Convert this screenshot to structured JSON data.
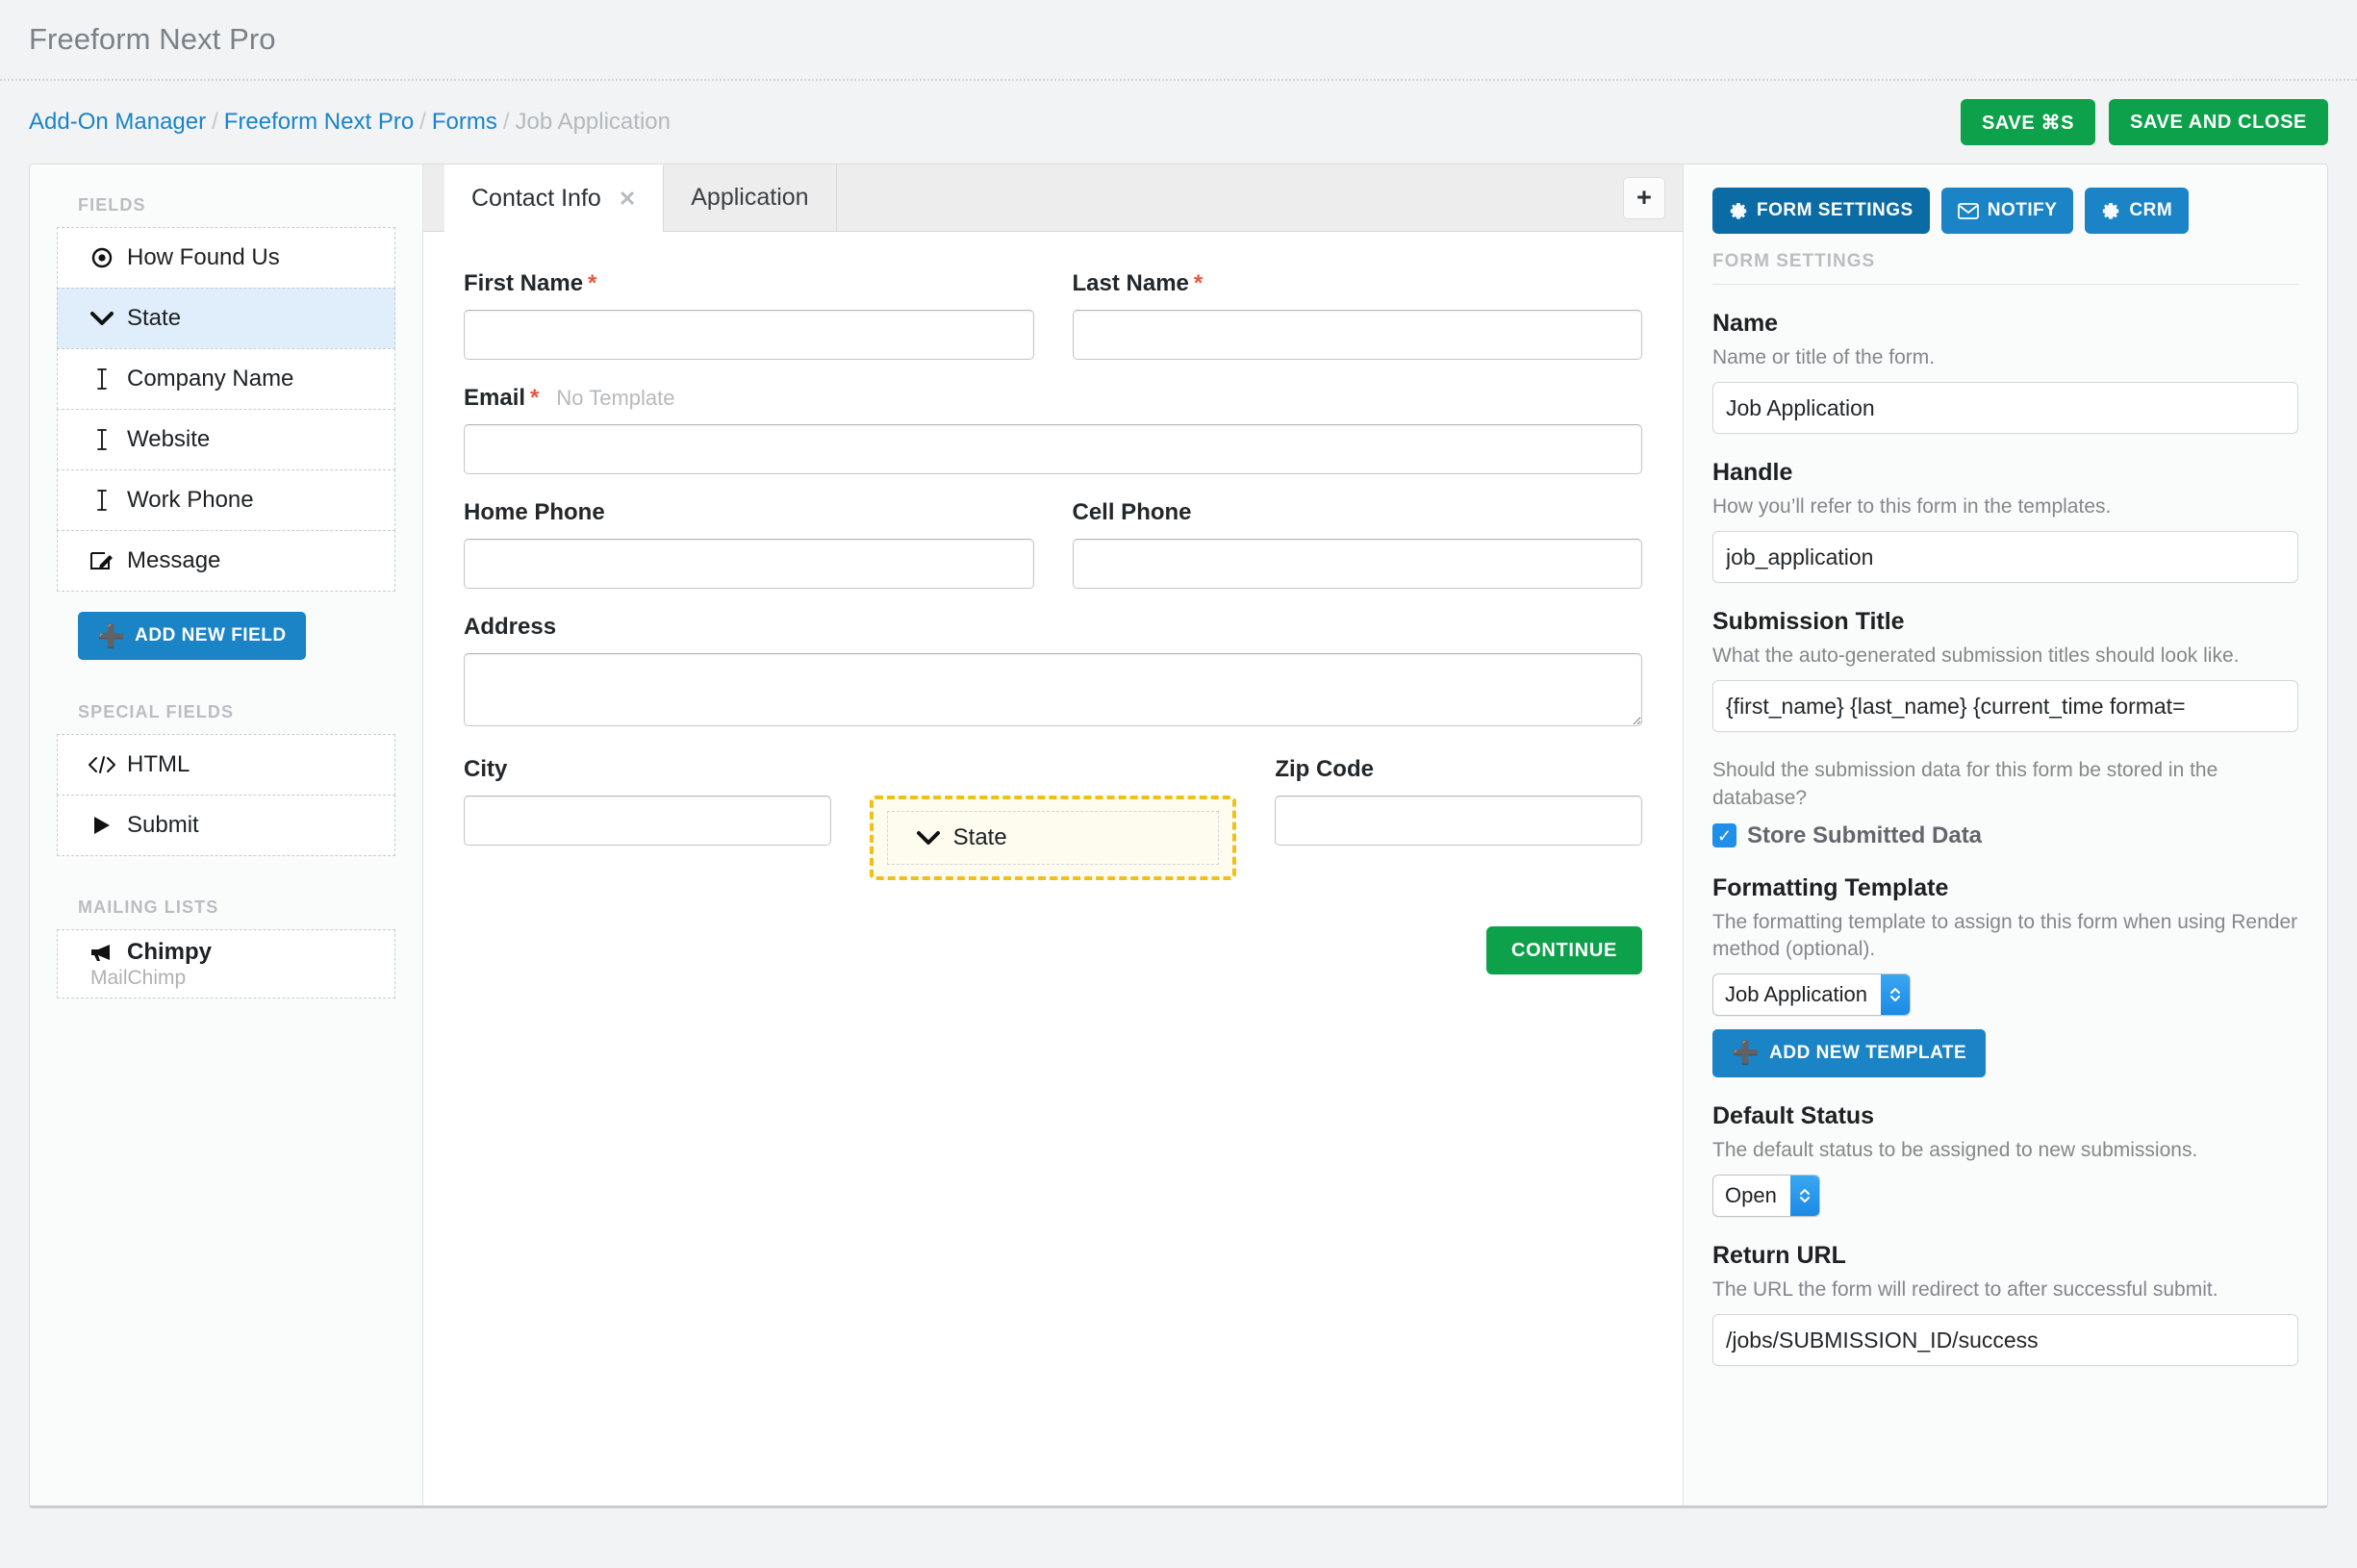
{
  "app": {
    "title": "Freeform Next Pro"
  },
  "breadcrumb": {
    "items": [
      "Add-On Manager",
      "Freeform Next Pro",
      "Forms",
      "Job Application"
    ],
    "separator": "/"
  },
  "actions": {
    "save_label": "SAVE ⌘S",
    "save_close_label": "SAVE AND CLOSE"
  },
  "sidebar": {
    "fields_heading": "FIELDS",
    "fields": [
      {
        "label": "How Found Us",
        "icon": "radio-icon"
      },
      {
        "label": "State",
        "icon": "chevron-down-icon",
        "active": true
      },
      {
        "label": "Company Name",
        "icon": "text-cursor-icon"
      },
      {
        "label": "Website",
        "icon": "text-cursor-icon"
      },
      {
        "label": "Work Phone",
        "icon": "text-cursor-icon"
      },
      {
        "label": "Message",
        "icon": "textarea-pencil-icon"
      }
    ],
    "add_field_label": "ADD NEW FIELD",
    "special_heading": "SPECIAL FIELDS",
    "special": [
      {
        "label": "HTML",
        "icon": "code-icon"
      },
      {
        "label": "Submit",
        "icon": "play-icon"
      }
    ],
    "mailing_heading": "MAILING LISTS",
    "mailing": [
      {
        "label": "Chimpy",
        "sub": "MailChimp",
        "icon": "megaphone-icon"
      }
    ]
  },
  "tabs": {
    "items": [
      {
        "label": "Contact Info",
        "active": true,
        "closable": true
      },
      {
        "label": "Application",
        "active": false,
        "closable": false
      }
    ],
    "add_label": "+"
  },
  "form": {
    "rows": [
      {
        "fields": [
          {
            "label": "First Name",
            "required": true,
            "type": "input"
          },
          {
            "label": "Last Name",
            "required": true,
            "type": "input"
          }
        ]
      },
      {
        "fields": [
          {
            "label": "Email",
            "required": true,
            "note": "No Template",
            "type": "input",
            "full": true
          }
        ]
      },
      {
        "fields": [
          {
            "label": "Home Phone",
            "required": false,
            "type": "input"
          },
          {
            "label": "Cell Phone",
            "required": false,
            "type": "input"
          }
        ]
      },
      {
        "fields": [
          {
            "label": "Address",
            "required": false,
            "type": "textarea",
            "full": true
          }
        ]
      },
      {
        "fields": [
          {
            "label": "City",
            "required": false,
            "type": "input"
          },
          {
            "label": "State",
            "type": "drop-target",
            "icon": "chevron-down-icon"
          },
          {
            "label": "Zip Code",
            "required": false,
            "type": "input"
          }
        ]
      }
    ],
    "continue_label": "CONTINUE"
  },
  "settings": {
    "tabs": [
      {
        "label": "FORM SETTINGS",
        "icon": "gear-icon",
        "active": true
      },
      {
        "label": "NOTIFY",
        "icon": "envelope-icon",
        "active": false
      },
      {
        "label": "CRM",
        "icon": "gear-icon",
        "active": false
      }
    ],
    "panel_title": "FORM SETTINGS",
    "name": {
      "label": "Name",
      "desc": "Name or title of the form.",
      "value": "Job Application"
    },
    "handle": {
      "label": "Handle",
      "desc": "How you’ll refer to this form in the templates.",
      "value": "job_application"
    },
    "submission_title": {
      "label": "Submission Title",
      "desc": "What the auto-generated submission titles should look like.",
      "value": "{first_name} {last_name} {current_time format="
    },
    "store": {
      "desc": "Should the submission data for this form be stored in the database?",
      "checkbox_label": "Store Submitted Data",
      "checked": true,
      "check_glyph": "✓"
    },
    "formatting_template": {
      "label": "Formatting Template",
      "desc": "The formatting template to assign to this form when using Render method (optional).",
      "value": "Job Application",
      "add_label": "ADD NEW TEMPLATE"
    },
    "default_status": {
      "label": "Default Status",
      "desc": "The default status to be assigned to new submissions.",
      "value": "Open"
    },
    "return_url": {
      "label": "Return URL",
      "desc": "The URL the form will redirect to after successful submit.",
      "value": "/jobs/SUBMISSION_ID/success"
    }
  },
  "colors": {
    "accent_blue": "#1b84c7",
    "accent_blue_dark": "#0b6ba5",
    "green": "#0ca14a",
    "drop_yellow": "#efc018",
    "required_red": "#e8563c",
    "selected_row": "#dfeefa"
  }
}
